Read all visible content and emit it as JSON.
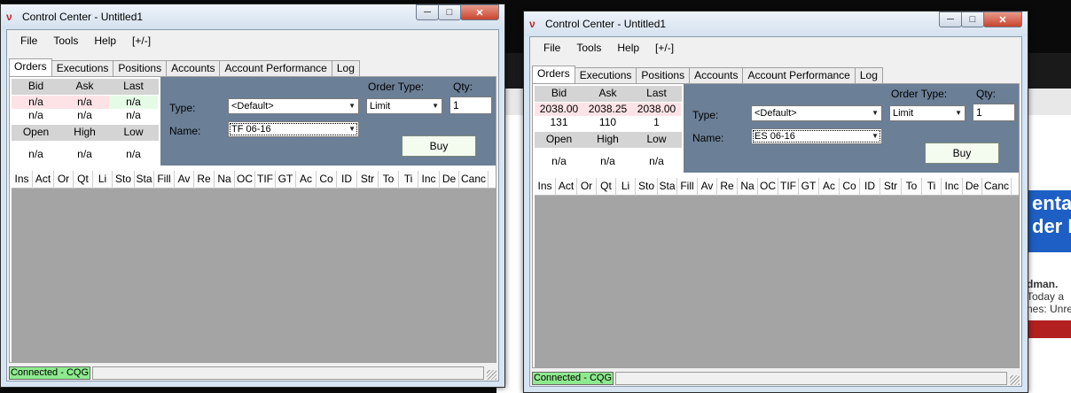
{
  "windows": [
    {
      "title": "Control Center - Untitled1",
      "menu": [
        "File",
        "Tools",
        "Help",
        "[+/-]"
      ],
      "tabs": [
        "Orders",
        "Executions",
        "Positions",
        "Accounts",
        "Account Performance",
        "Log"
      ],
      "quote": {
        "headers": [
          "Bid",
          "Ask",
          "Last"
        ],
        "row1": [
          "n/a",
          "n/a",
          "n/a"
        ],
        "row2": [
          "n/a",
          "n/a",
          "n/a"
        ],
        "headers2": [
          "Open",
          "High",
          "Low"
        ],
        "row3": [
          "n/a",
          "n/a",
          "n/a"
        ]
      },
      "form": {
        "type_label": "Type:",
        "type_value": "<Default>",
        "name_label": "Name:",
        "name_value": "TF 06-16",
        "order_type_label": "Order Type:",
        "order_type_value": "Limit",
        "qty_label": "Qty:",
        "qty_value": "1",
        "buy_label": "Buy"
      },
      "columns": [
        "Ins",
        "Act",
        "Or",
        "Qt",
        "Li",
        "Sto",
        "Sta",
        "Fill",
        "Av",
        "Re",
        "Na",
        "OC",
        "TIF",
        "GT",
        "Ac",
        "Co",
        "ID",
        "Str",
        "To",
        "Ti",
        "Inc",
        "De",
        "Canc"
      ],
      "status": "Connected - CQG"
    },
    {
      "title": "Control Center - Untitled1",
      "menu": [
        "File",
        "Tools",
        "Help",
        "[+/-]"
      ],
      "tabs": [
        "Orders",
        "Executions",
        "Positions",
        "Accounts",
        "Account Performance",
        "Log"
      ],
      "quote": {
        "headers": [
          "Bid",
          "Ask",
          "Last"
        ],
        "row1": [
          "2038.00",
          "2038.25",
          "2038.00"
        ],
        "row2": [
          "131",
          "110",
          "1"
        ],
        "headers2": [
          "Open",
          "High",
          "Low"
        ],
        "row3": [
          "n/a",
          "n/a",
          "n/a"
        ]
      },
      "form": {
        "type_label": "Type:",
        "type_value": "<Default>",
        "name_label": "Name:",
        "name_value": "ES 06-16",
        "order_type_label": "Order Type:",
        "order_type_value": "Limit",
        "qty_label": "Qty:",
        "qty_value": "1",
        "buy_label": "Buy"
      },
      "columns": [
        "Ins",
        "Act",
        "Or",
        "Qt",
        "Li",
        "Sto",
        "Sta",
        "Fill",
        "Av",
        "Re",
        "Na",
        "OC",
        "TIF",
        "GT",
        "Ac",
        "Co",
        "ID",
        "Str",
        "To",
        "Ti",
        "Inc",
        "De",
        "Canc"
      ],
      "status": "Connected - CQG"
    }
  ],
  "background_page": {
    "fragments": [
      "entary",
      "der Bl",
      "dman.",
      "Today a",
      "nes: Unre"
    ]
  },
  "colors": {
    "bid_cell": "#fde3e6",
    "last_cell": "#e6fbe6",
    "form_panel": "#6b7f96",
    "grid_area": "#a4a4a4",
    "connected": "#8eea8e",
    "buy_button": "#f4fcf0"
  }
}
